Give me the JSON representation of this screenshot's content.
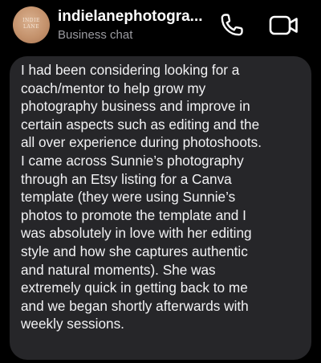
{
  "header": {
    "avatar_text": "INDIE\nLANE",
    "name": "indielanephotogra...",
    "subtitle": "Business chat",
    "call_icon": "phone-icon",
    "video_icon": "video-camera-icon"
  },
  "message": {
    "text": "I had been considering looking for a\ncoach/mentor to help grow my\nphotography business and improve in\ncertain aspects such as editing and the\nall over experience during photoshoots.\nI came across Sunnie’s photography\nthrough an Etsy listing for a Canva\ntemplate (they were using Sunnie’s\nphotos to promote the template and I\nwas absolutely in love with her editing\nstyle and how she captures authentic\nand natural moments). She was\nextremely quick in getting back to me\nand we began shortly afterwards with\nweekly sessions."
  },
  "colors": {
    "background": "#000000",
    "bubble": "#262629",
    "text": "#f2f2f4",
    "secondary_text": "#9b9ba0",
    "avatar": "#c4926c"
  }
}
